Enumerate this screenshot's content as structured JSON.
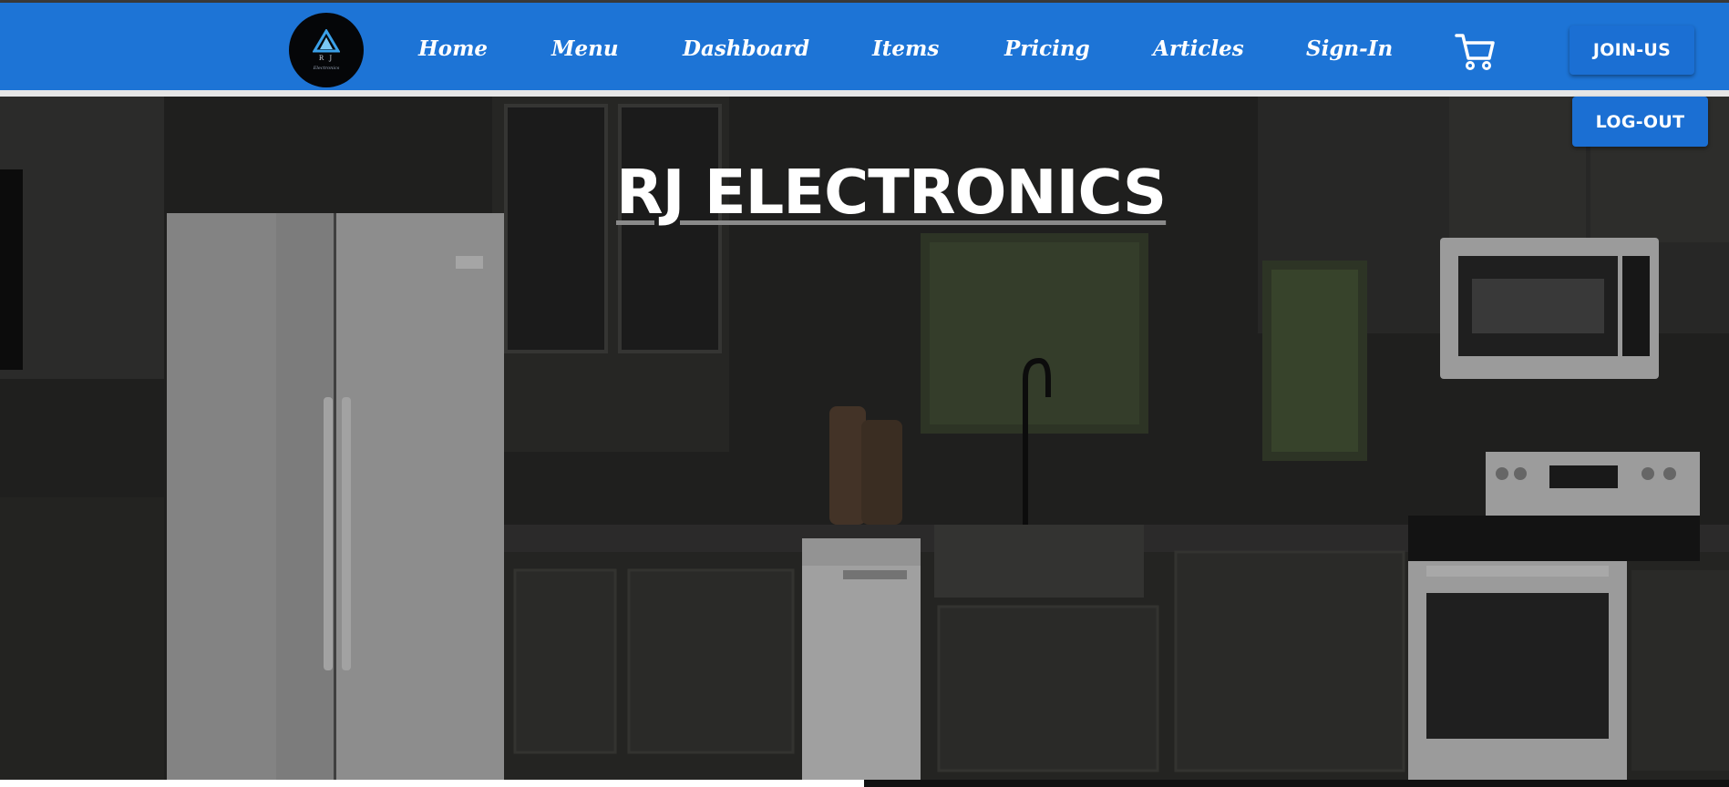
{
  "header": {
    "logo": {
      "name": "rj-logo",
      "text": "R J",
      "subtext": "Electronics"
    },
    "nav": [
      {
        "label": "Home"
      },
      {
        "label": "Menu"
      },
      {
        "label": "Dashboard"
      },
      {
        "label": "Items"
      },
      {
        "label": "Pricing"
      },
      {
        "label": "Articles"
      },
      {
        "label": "Sign-In"
      }
    ],
    "cart_icon": "shopping-cart-icon",
    "join_label": "JOIN-US",
    "logout_label": "LOG-OUT"
  },
  "hero": {
    "title": "RJ ELECTRONICS",
    "image_subject": "kitchen-appliances-photo"
  },
  "colors": {
    "navbar": "#1d74d6",
    "button": "#1b6fd3",
    "text": "#ffffff"
  }
}
